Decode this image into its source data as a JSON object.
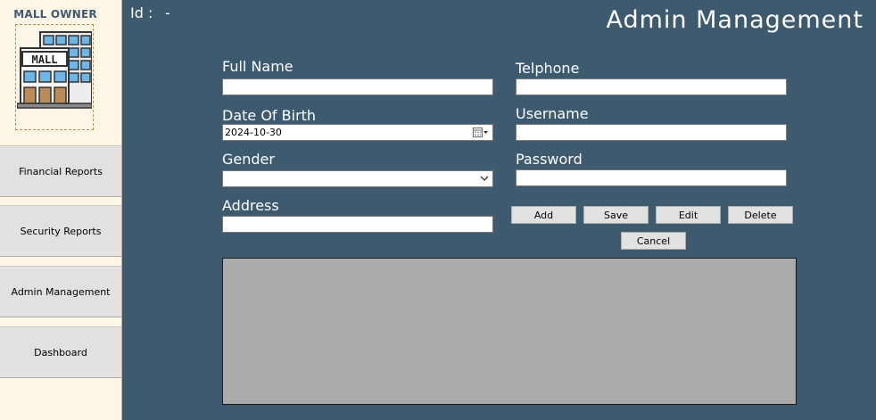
{
  "sidebar": {
    "brand_title": "MALL OWNER",
    "logo_text": "MALL",
    "items": [
      {
        "label": "Financial Reports"
      },
      {
        "label": "Security Reports"
      },
      {
        "label": "Admin Management"
      },
      {
        "label": "Dashboard"
      }
    ]
  },
  "header": {
    "id_label": "Id :",
    "id_value": "-",
    "title": "Admin Management"
  },
  "form": {
    "full_name": {
      "label": "Full Name",
      "value": ""
    },
    "date_of_birth": {
      "label": "Date Of Birth",
      "value": "2024-10-30"
    },
    "gender": {
      "label": "Gender",
      "value": ""
    },
    "address": {
      "label": "Address",
      "value": ""
    },
    "telephone": {
      "label": "Telphone",
      "value": ""
    },
    "username": {
      "label": "Username",
      "value": ""
    },
    "password": {
      "label": "Password",
      "value": ""
    }
  },
  "buttons": {
    "add": "Add",
    "save": "Save",
    "edit": "Edit",
    "delete": "Delete",
    "cancel": "Cancel"
  },
  "icons": {
    "logo": "mall-building-icon",
    "calendar": "calendar-icon",
    "dropdown": "chevron-down-icon"
  },
  "colors": {
    "main_background": "#3e5a6f",
    "sidebar_background": "#fdf5e6",
    "grid_background": "#ababab"
  }
}
